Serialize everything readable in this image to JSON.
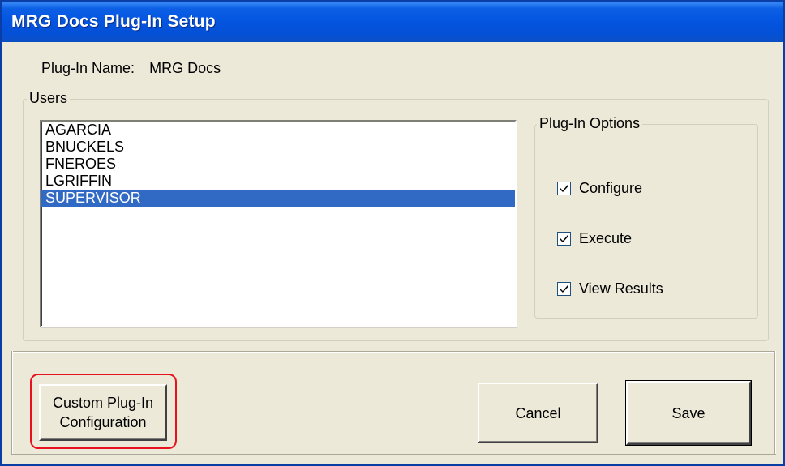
{
  "window": {
    "title": "MRG Docs Plug-In Setup"
  },
  "plugin_name": {
    "label": "Plug-In Name:",
    "value": "MRG Docs"
  },
  "users": {
    "legend": "Users",
    "items": [
      {
        "name": "AGARCIA",
        "selected": false
      },
      {
        "name": "BNUCKELS",
        "selected": false
      },
      {
        "name": "FNEROES",
        "selected": false
      },
      {
        "name": "LGRIFFIN",
        "selected": false
      },
      {
        "name": "SUPERVISOR",
        "selected": true
      }
    ]
  },
  "options": {
    "legend": "Plug-In Options",
    "items": [
      {
        "label": "Configure",
        "checked": true
      },
      {
        "label": "Execute",
        "checked": true
      },
      {
        "label": "View Results",
        "checked": true
      }
    ]
  },
  "buttons": {
    "custom_config": "Custom Plug-In\nConfiguration",
    "cancel": "Cancel",
    "save": "Save"
  },
  "colors": {
    "title_bar": "#0454e0",
    "selection": "#316ac5",
    "highlight": "#e8121f",
    "face": "#ece9d8"
  }
}
